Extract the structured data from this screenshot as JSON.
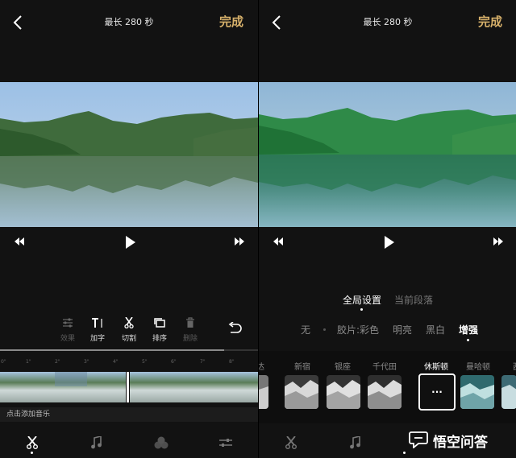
{
  "left": {
    "header": {
      "title": "最长 280 秒",
      "done_label": "完成"
    },
    "tools": [
      {
        "label": "效果",
        "icon": "sliders-icon",
        "enabled": false
      },
      {
        "label": "加字",
        "icon": "text-icon",
        "enabled": true
      },
      {
        "label": "切割",
        "icon": "scissors-icon",
        "enabled": true
      },
      {
        "label": "排序",
        "icon": "reorder-icon",
        "enabled": true
      },
      {
        "label": "删除",
        "icon": "trash-icon",
        "enabled": false
      }
    ],
    "timeline_ticks": [
      "0\"",
      "1\"",
      "2\"",
      "3\"",
      "4\"",
      "5\"",
      "6\"",
      "7\"",
      "8\""
    ],
    "music_label": "点击添加音乐",
    "nav": [
      "scissors-icon",
      "music-note-icon",
      "filter-circles-icon",
      "adjust-icon"
    ]
  },
  "right": {
    "header": {
      "title": "最长 280 秒",
      "done_label": "完成"
    },
    "segments": {
      "global": "全局设置",
      "current": "当前段落",
      "selected": "global"
    },
    "filter_types": {
      "none": "无",
      "film_color": "胶片:彩色",
      "bright": "明亮",
      "bw": "黑白",
      "enhance": "增强",
      "selected": "enhance"
    },
    "filters": {
      "partial": "达",
      "names": [
        "新宿",
        "银座",
        "千代田",
        "休斯顿",
        "曼哈顿",
        "西"
      ],
      "selected": "休斯顿",
      "selected_glyph": "···"
    },
    "nav": [
      "scissors-icon",
      "music-note-icon"
    ],
    "watermark": "悟空问答"
  },
  "colors": {
    "accent": "#d6b06a",
    "background": "#121212"
  }
}
